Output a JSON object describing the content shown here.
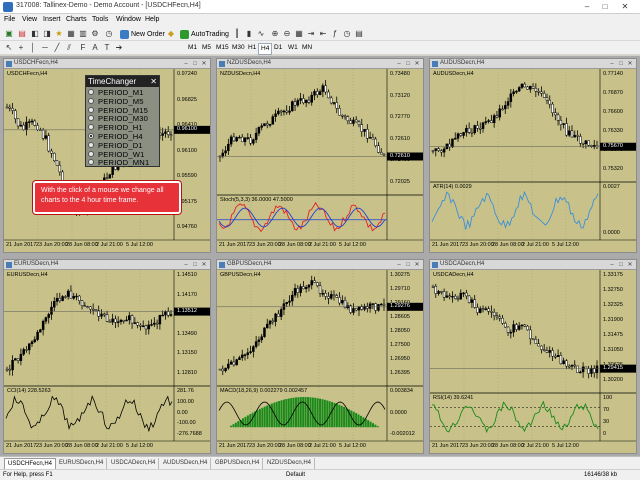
{
  "window": {
    "title": "317008: Tallinex-Demo - Demo Account - [USDCHFecn,H4]",
    "buttons": {
      "minimize": "–",
      "maximize": "□",
      "close": "✕"
    }
  },
  "menu": [
    "File",
    "View",
    "Insert",
    "Charts",
    "Tools",
    "Window",
    "Help"
  ],
  "toolbar": {
    "new_order": "New Order",
    "autotrading": "AutoTrading",
    "timeframes": [
      "M1",
      "M5",
      "M15",
      "M30",
      "H1",
      "H4",
      "D1",
      "W1",
      "MN"
    ],
    "active_timeframe": "H4"
  },
  "charts": [
    {
      "title": "USDCHFecn,H4",
      "label": "USDCHFecn,H4",
      "prices": [
        "0.97240",
        "0.96825",
        "0.96410",
        "0.96100",
        "0.95590",
        "0.95175",
        "0.94760"
      ],
      "dates": [
        "21 Jun 2017",
        "23 Jun 20:00",
        "28 Jun 08:00",
        "2 Jul 21:00",
        "5 Jul 12:00"
      ],
      "current": "0.96100"
    },
    {
      "title": "NZDUSDecn,H4",
      "label": "NZDUSDecn,H4",
      "prices": [
        "0.73480",
        "0.73120",
        "0.72770",
        "0.72610",
        "0.72400",
        "0.72025"
      ],
      "dates": [
        "21 Jun 2017",
        "23 Jun 20:00",
        "28 Jun 08:00",
        "2 Jul 21:00",
        "5 Jul 12:00"
      ],
      "current": "0.72610",
      "indicator": "Stoch(5,3,3) 36.0000 47.5000"
    },
    {
      "title": "AUDUSDecn,H4",
      "label": "AUDUSDecn,H4",
      "prices": [
        "0.77140",
        "0.76870",
        "0.76600",
        "0.76330",
        "0.75670",
        "0.75320"
      ],
      "dates": [
        "21 Jun 2017",
        "23 Jun 20:00",
        "28 Jun 08:00",
        "2 Jul 21:00",
        "5 Jul 12:00"
      ],
      "current": "0.75670",
      "indicator": "ATR(14) 0.0029",
      "indicator_scale": [
        "0.0027",
        "0.0000"
      ]
    },
    {
      "title": "EURUSDecn,H4",
      "label": "EURUSDecn,H4",
      "prices": [
        "1.14510",
        "1.14170",
        "1.13830",
        "1.13490",
        "1.13150",
        "1.12810"
      ],
      "dates": [
        "21 Jun 2017",
        "23 Jun 20:00",
        "28 Jun 08:00",
        "2 Jul 21:00",
        "5 Jul 12:00"
      ],
      "current": "1.13512",
      "indicator": "CCI(14) 228.5263",
      "indicator_scale": [
        "281.76",
        "100.00",
        "0.00",
        "-100.00",
        "-276.7688"
      ]
    },
    {
      "title": "GBPUSDecn,H4",
      "label": "GBPUSDecn,H4",
      "prices": [
        "1.30275",
        "1.29710",
        "1.29160",
        "1.28605",
        "1.28050",
        "1.27500",
        "1.26950",
        "1.26395"
      ],
      "dates": [
        "21 Jun 2017",
        "23 Jun 20:00",
        "28 Jun 08:00",
        "2 Jul 21:00",
        "5 Jul 12:00"
      ],
      "current": "1.29276",
      "indicator": "MACD(18,26,9) 0.002279 0.002457",
      "indicator_scale": [
        "0.003834",
        "0.0000",
        "-0.002012"
      ]
    },
    {
      "title": "USDCADecn,H4",
      "label": "USDCADecn,H4",
      "prices": [
        "1.33175",
        "1.32750",
        "1.32325",
        "1.31900",
        "1.31475",
        "1.31050",
        "1.30625",
        "1.30200"
      ],
      "dates": [
        "21 Jun 2017",
        "23 Jun 20:00",
        "28 Jun 08:00",
        "2 Jul 21:00",
        "5 Jul 12:00"
      ],
      "current": "1.29415",
      "indicator": "RSI(14) 39.6241",
      "indicator_scale": [
        "100",
        "70",
        "30",
        "0"
      ]
    }
  ],
  "timechanger": {
    "title": "TimeChanger",
    "close": "✕",
    "periods": [
      "PERIOD_M1",
      "PERIOD_M5",
      "PERIOD_M15",
      "PERIOD_M30",
      "PERIOD_H1",
      "PERIOD_H4",
      "PERIOD_D1",
      "PERIOD_W1",
      "PERIOD_MN1"
    ],
    "selected": "PERIOD_H4"
  },
  "callout": {
    "text": "With the click of a mouse we change all charts to the 4 hour time frame."
  },
  "tabs": [
    "USDCHFecn,H4",
    "EURUSDecn,H4",
    "USDCADecn,H4",
    "AUDUSDecn,H4",
    "GBPUSDecn,H4",
    "NZDUSDecn,H4"
  ],
  "active_tab": "USDCHFecn,H4",
  "status": {
    "help": "For Help, press F1",
    "profile": "Default",
    "traffic": "16146/38 kb"
  },
  "colors": {
    "chart_bg": "#c8c28a",
    "candle": "#000000",
    "callout": "#e8323a",
    "stoch_main": "#1f3fcf",
    "stoch_signal": "#e81e1e",
    "atr": "#3a8fd8",
    "macd": "#1a8a1a",
    "rsi": "#1a8a1a"
  }
}
